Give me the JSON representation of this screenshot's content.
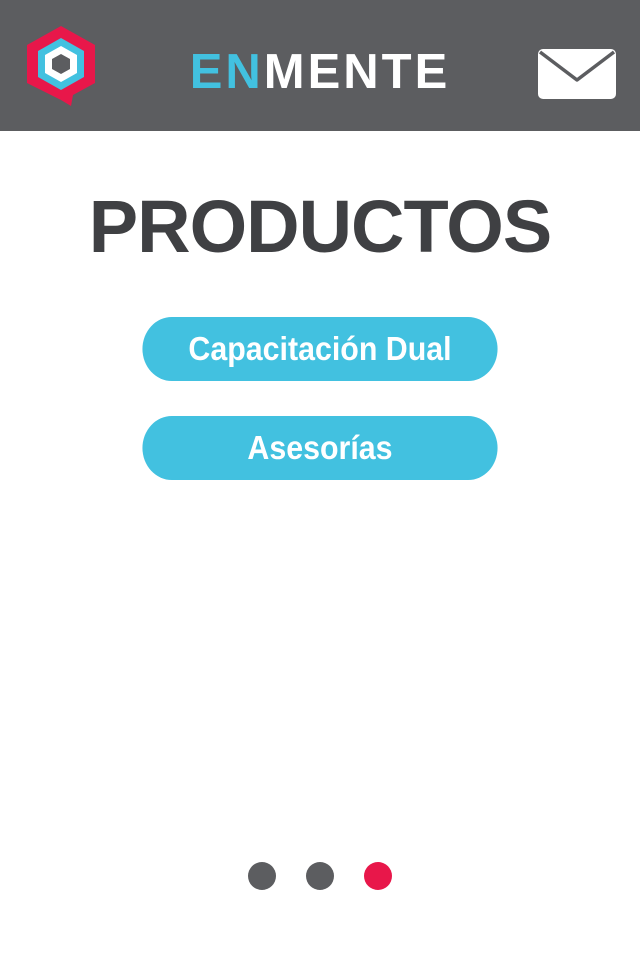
{
  "header": {
    "brand_part1": "EN",
    "brand_part2": "MENTE",
    "logo_icon": "hexagon-chat-logo",
    "mail_icon": "envelope-icon",
    "background_color": "#5c5d60",
    "brand_accent_color": "#42c1e0"
  },
  "main": {
    "title": "PRODUCTOS",
    "buttons": [
      {
        "label": "Capacitación Dual"
      },
      {
        "label": "Asesorías"
      }
    ],
    "button_color": "#42c1e0"
  },
  "pagination": {
    "total_pages": 3,
    "current_page": 3,
    "inactive_color": "#5c5d60",
    "active_color": "#e8174a"
  }
}
